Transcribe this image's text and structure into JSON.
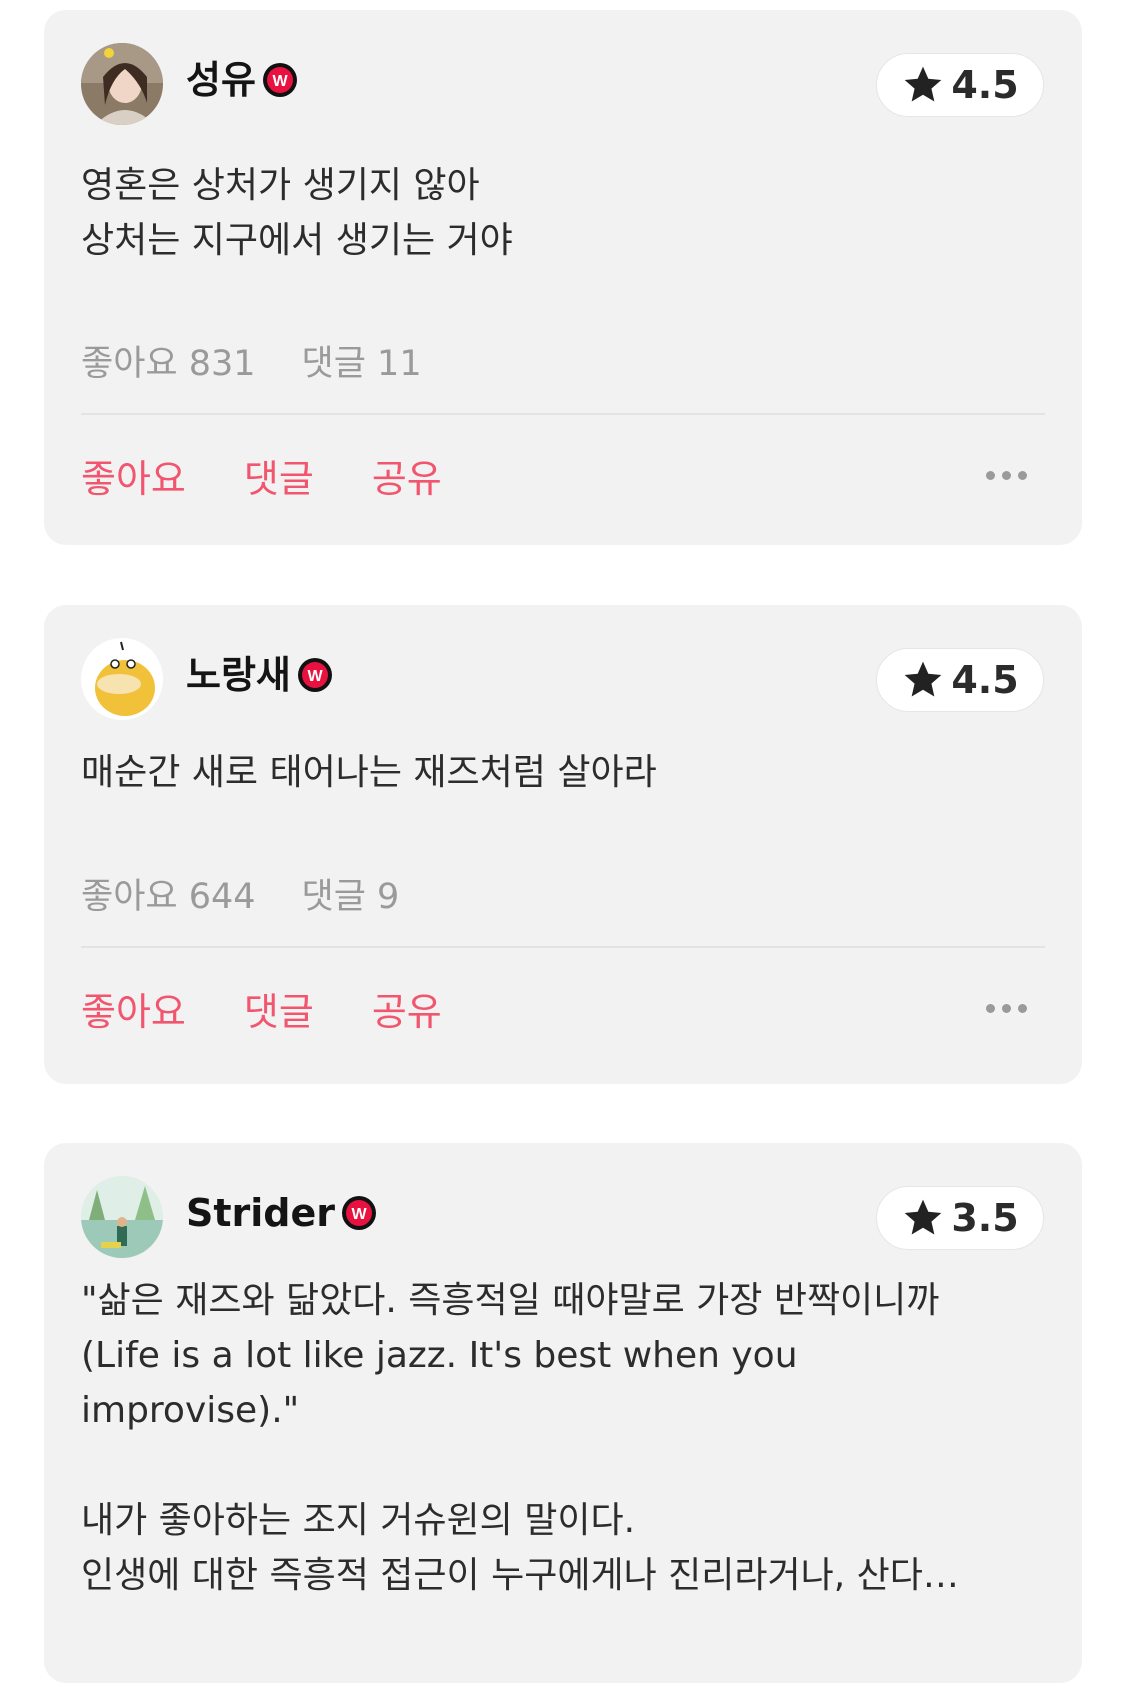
{
  "posts": [
    {
      "username": "성유",
      "rating": "4.5",
      "text": "영혼은 상처가 생기지 않아\n상처는 지구에서 생기는 거야",
      "likes_label": "좋아요 831",
      "comments_label": "댓글 11",
      "action_like": "좋아요",
      "action_comment": "댓글",
      "action_share": "공유"
    },
    {
      "username": "노랑새",
      "rating": "4.5",
      "text": "매순간 새로 태어나는 재즈처럼 살아라",
      "likes_label": "좋아요 644",
      "comments_label": "댓글 9",
      "action_like": "좋아요",
      "action_comment": "댓글",
      "action_share": "공유"
    },
    {
      "username": "Strider",
      "rating": "3.5",
      "text": "\"삶은 재즈와 닮았다. 즉흥적일 때야말로 가장 반짝이니까\n(Life is a lot like jazz. It's best when you\nimprovise).\"\n\n내가 좋아하는 조지 거슈윈의 말이다.\n인생에 대한 즉흥적 접근이 누구에게나 진리라거나, 산다…"
    }
  ],
  "colors": {
    "card_bg": "#f2f2f2",
    "action_pink": "#f1566e",
    "meta_gray": "#9a9a9a",
    "badge_red": "#e8113f"
  },
  "icons": {
    "badge": "watcha-w-badge-icon",
    "star": "star-icon",
    "more": "more-dots-icon"
  }
}
